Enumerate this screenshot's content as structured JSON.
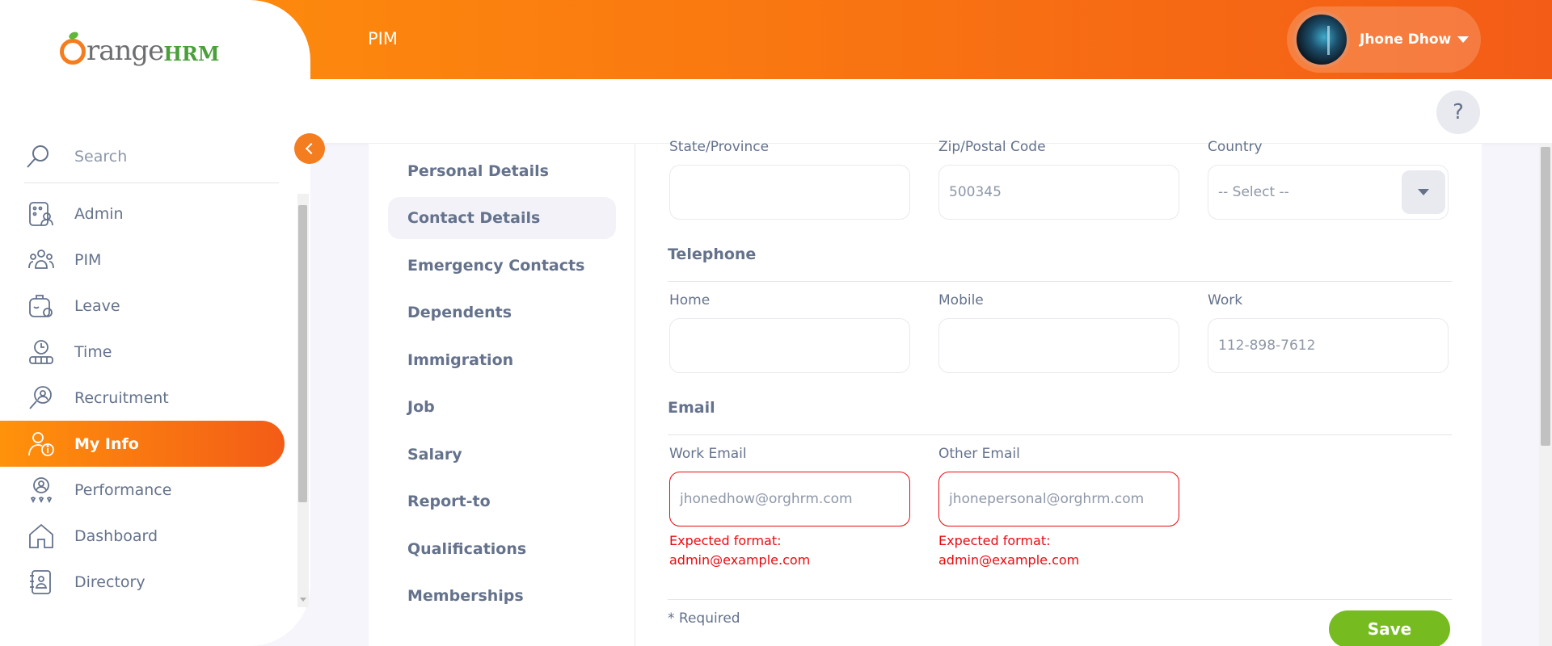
{
  "header": {
    "module_title": "PIM",
    "user_name": "Jhone Dhow",
    "help_label": "?"
  },
  "brand": {
    "logo_text_main": "Orange",
    "logo_text_hrm": "HRM",
    "accent_color": "#f47d20",
    "active_gradient": [
      "#ff920b",
      "#f35c17"
    ],
    "save_color": "#76bc21",
    "error_color": "#eb0910"
  },
  "sidebar": {
    "search_label": "Search",
    "items": [
      {
        "label": "Admin",
        "icon": "admin-icon"
      },
      {
        "label": "PIM",
        "icon": "pim-icon"
      },
      {
        "label": "Leave",
        "icon": "leave-icon"
      },
      {
        "label": "Time",
        "icon": "time-icon"
      },
      {
        "label": "Recruitment",
        "icon": "recruitment-icon"
      },
      {
        "label": "My Info",
        "icon": "my-info-icon",
        "active": true
      },
      {
        "label": "Performance",
        "icon": "performance-icon"
      },
      {
        "label": "Dashboard",
        "icon": "dashboard-icon"
      },
      {
        "label": "Directory",
        "icon": "directory-icon"
      }
    ]
  },
  "tabs": [
    {
      "label": "Personal Details"
    },
    {
      "label": "Contact Details",
      "active": true
    },
    {
      "label": "Emergency Contacts"
    },
    {
      "label": "Dependents"
    },
    {
      "label": "Immigration"
    },
    {
      "label": "Job"
    },
    {
      "label": "Salary"
    },
    {
      "label": "Report-to"
    },
    {
      "label": "Qualifications"
    },
    {
      "label": "Memberships"
    }
  ],
  "form": {
    "address": {
      "state_label": "State/Province",
      "state_value": "",
      "zip_label": "Zip/Postal Code",
      "zip_value": "500345",
      "country_label": "Country",
      "country_value": "-- Select --"
    },
    "telephone": {
      "title": "Telephone",
      "home_label": "Home",
      "home_value": "",
      "mobile_label": "Mobile",
      "mobile_value": "",
      "work_label": "Work",
      "work_value": "112-898-7612"
    },
    "email": {
      "title": "Email",
      "work_label": "Work Email",
      "work_value": "jhonedhow@orghrm.com",
      "work_error_line1": "Expected format:",
      "work_error_line2": "admin@example.com",
      "other_label": "Other Email",
      "other_value": "jhonepersonal@orghrm.com",
      "other_error_line1": "Expected format:",
      "other_error_line2": "admin@example.com"
    },
    "required_note": "* Required",
    "save_label": "Save"
  }
}
